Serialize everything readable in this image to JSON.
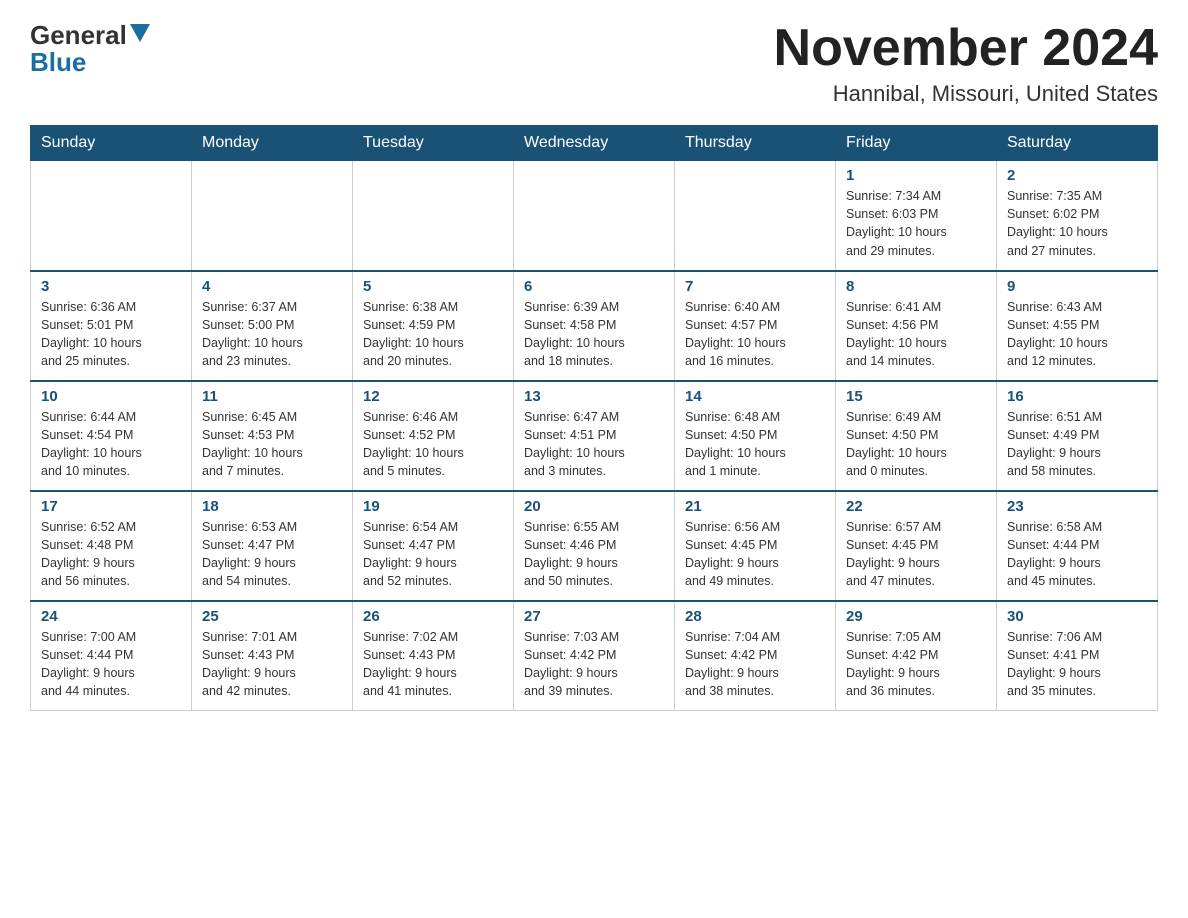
{
  "header": {
    "logo_general": "General",
    "logo_blue": "Blue",
    "calendar_title": "November 2024",
    "calendar_subtitle": "Hannibal, Missouri, United States"
  },
  "days_of_week": [
    "Sunday",
    "Monday",
    "Tuesday",
    "Wednesday",
    "Thursday",
    "Friday",
    "Saturday"
  ],
  "weeks": [
    {
      "days": [
        {
          "number": "",
          "info": ""
        },
        {
          "number": "",
          "info": ""
        },
        {
          "number": "",
          "info": ""
        },
        {
          "number": "",
          "info": ""
        },
        {
          "number": "",
          "info": ""
        },
        {
          "number": "1",
          "info": "Sunrise: 7:34 AM\nSunset: 6:03 PM\nDaylight: 10 hours\nand 29 minutes."
        },
        {
          "number": "2",
          "info": "Sunrise: 7:35 AM\nSunset: 6:02 PM\nDaylight: 10 hours\nand 27 minutes."
        }
      ]
    },
    {
      "days": [
        {
          "number": "3",
          "info": "Sunrise: 6:36 AM\nSunset: 5:01 PM\nDaylight: 10 hours\nand 25 minutes."
        },
        {
          "number": "4",
          "info": "Sunrise: 6:37 AM\nSunset: 5:00 PM\nDaylight: 10 hours\nand 23 minutes."
        },
        {
          "number": "5",
          "info": "Sunrise: 6:38 AM\nSunset: 4:59 PM\nDaylight: 10 hours\nand 20 minutes."
        },
        {
          "number": "6",
          "info": "Sunrise: 6:39 AM\nSunset: 4:58 PM\nDaylight: 10 hours\nand 18 minutes."
        },
        {
          "number": "7",
          "info": "Sunrise: 6:40 AM\nSunset: 4:57 PM\nDaylight: 10 hours\nand 16 minutes."
        },
        {
          "number": "8",
          "info": "Sunrise: 6:41 AM\nSunset: 4:56 PM\nDaylight: 10 hours\nand 14 minutes."
        },
        {
          "number": "9",
          "info": "Sunrise: 6:43 AM\nSunset: 4:55 PM\nDaylight: 10 hours\nand 12 minutes."
        }
      ]
    },
    {
      "days": [
        {
          "number": "10",
          "info": "Sunrise: 6:44 AM\nSunset: 4:54 PM\nDaylight: 10 hours\nand 10 minutes."
        },
        {
          "number": "11",
          "info": "Sunrise: 6:45 AM\nSunset: 4:53 PM\nDaylight: 10 hours\nand 7 minutes."
        },
        {
          "number": "12",
          "info": "Sunrise: 6:46 AM\nSunset: 4:52 PM\nDaylight: 10 hours\nand 5 minutes."
        },
        {
          "number": "13",
          "info": "Sunrise: 6:47 AM\nSunset: 4:51 PM\nDaylight: 10 hours\nand 3 minutes."
        },
        {
          "number": "14",
          "info": "Sunrise: 6:48 AM\nSunset: 4:50 PM\nDaylight: 10 hours\nand 1 minute."
        },
        {
          "number": "15",
          "info": "Sunrise: 6:49 AM\nSunset: 4:50 PM\nDaylight: 10 hours\nand 0 minutes."
        },
        {
          "number": "16",
          "info": "Sunrise: 6:51 AM\nSunset: 4:49 PM\nDaylight: 9 hours\nand 58 minutes."
        }
      ]
    },
    {
      "days": [
        {
          "number": "17",
          "info": "Sunrise: 6:52 AM\nSunset: 4:48 PM\nDaylight: 9 hours\nand 56 minutes."
        },
        {
          "number": "18",
          "info": "Sunrise: 6:53 AM\nSunset: 4:47 PM\nDaylight: 9 hours\nand 54 minutes."
        },
        {
          "number": "19",
          "info": "Sunrise: 6:54 AM\nSunset: 4:47 PM\nDaylight: 9 hours\nand 52 minutes."
        },
        {
          "number": "20",
          "info": "Sunrise: 6:55 AM\nSunset: 4:46 PM\nDaylight: 9 hours\nand 50 minutes."
        },
        {
          "number": "21",
          "info": "Sunrise: 6:56 AM\nSunset: 4:45 PM\nDaylight: 9 hours\nand 49 minutes."
        },
        {
          "number": "22",
          "info": "Sunrise: 6:57 AM\nSunset: 4:45 PM\nDaylight: 9 hours\nand 47 minutes."
        },
        {
          "number": "23",
          "info": "Sunrise: 6:58 AM\nSunset: 4:44 PM\nDaylight: 9 hours\nand 45 minutes."
        }
      ]
    },
    {
      "days": [
        {
          "number": "24",
          "info": "Sunrise: 7:00 AM\nSunset: 4:44 PM\nDaylight: 9 hours\nand 44 minutes."
        },
        {
          "number": "25",
          "info": "Sunrise: 7:01 AM\nSunset: 4:43 PM\nDaylight: 9 hours\nand 42 minutes."
        },
        {
          "number": "26",
          "info": "Sunrise: 7:02 AM\nSunset: 4:43 PM\nDaylight: 9 hours\nand 41 minutes."
        },
        {
          "number": "27",
          "info": "Sunrise: 7:03 AM\nSunset: 4:42 PM\nDaylight: 9 hours\nand 39 minutes."
        },
        {
          "number": "28",
          "info": "Sunrise: 7:04 AM\nSunset: 4:42 PM\nDaylight: 9 hours\nand 38 minutes."
        },
        {
          "number": "29",
          "info": "Sunrise: 7:05 AM\nSunset: 4:42 PM\nDaylight: 9 hours\nand 36 minutes."
        },
        {
          "number": "30",
          "info": "Sunrise: 7:06 AM\nSunset: 4:41 PM\nDaylight: 9 hours\nand 35 minutes."
        }
      ]
    }
  ]
}
